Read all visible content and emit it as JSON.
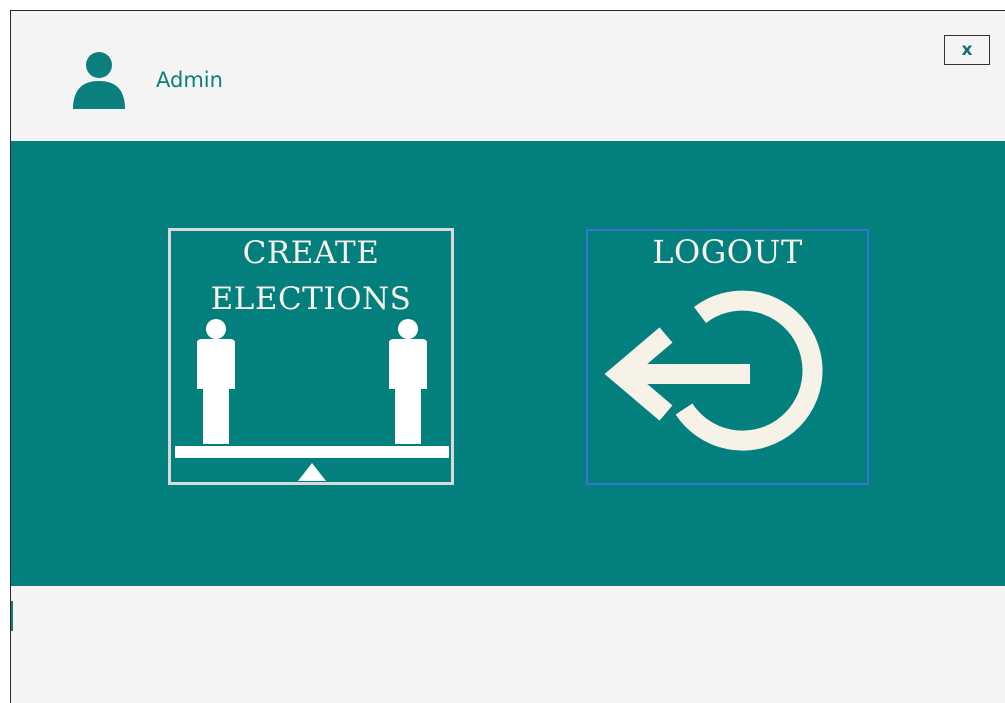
{
  "header": {
    "user_label": "Admin",
    "avatar_icon": "user-icon",
    "close_label": "x"
  },
  "tiles": {
    "create": {
      "line1": "CREATE",
      "line2": "ELECTIONS",
      "icon": "people-balance-icon"
    },
    "logout": {
      "label": "LOGOUT",
      "icon": "logout-arrow-icon"
    }
  },
  "colors": {
    "teal": "#037f7e",
    "background": "#f4f4f4",
    "icon_fill": "#f6f2e8",
    "focus_border": "#3a73d0"
  }
}
